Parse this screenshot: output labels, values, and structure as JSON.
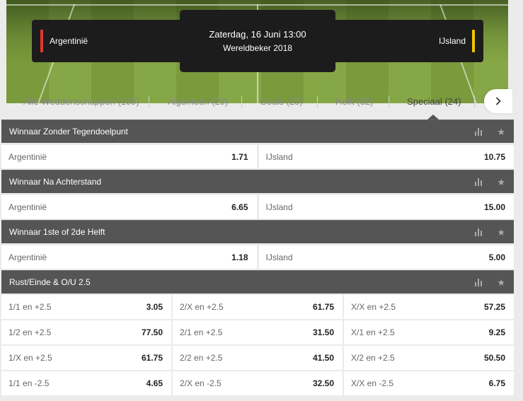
{
  "match": {
    "home_team": "Argentinië",
    "away_team": "IJsland",
    "date": "Zaterdag, 16 Juni 13:00",
    "competition": "Wereldbeker 2018",
    "home_color": "#e03a2c",
    "away_color": "#f2c200"
  },
  "tabs": [
    {
      "label": "Alle Weddenschappen (109)"
    },
    {
      "label": "Algemeen (29)"
    },
    {
      "label": "Goals (25)"
    },
    {
      "label": "Helft (32)"
    },
    {
      "label": "Speciaal (24)",
      "active": true
    }
  ],
  "tab_next_icon": "chevron-right-icon",
  "markets": [
    {
      "title": "Winnaar Zonder Tegendoelpunt",
      "outcomes": [
        {
          "label": "Argentinië",
          "odds": "1.71"
        },
        {
          "label": "IJsland",
          "odds": "10.75"
        }
      ]
    },
    {
      "title": "Winnaar Na Achterstand",
      "outcomes": [
        {
          "label": "Argentinië",
          "odds": "6.65"
        },
        {
          "label": "IJsland",
          "odds": "15.00"
        }
      ]
    },
    {
      "title": "Winnaar 1ste of 2de Helft",
      "outcomes": [
        {
          "label": "Argentinië",
          "odds": "1.18"
        },
        {
          "label": "IJsland",
          "odds": "5.00"
        }
      ]
    },
    {
      "title": "Rust/Einde & O/U 2.5",
      "rows": [
        [
          {
            "label": "1/1 en +2.5",
            "odds": "3.05"
          },
          {
            "label": "2/X en +2.5",
            "odds": "61.75"
          },
          {
            "label": "X/X en +2.5",
            "odds": "57.25"
          }
        ],
        [
          {
            "label": "1/2 en +2.5",
            "odds": "77.50"
          },
          {
            "label": "2/1 en +2.5",
            "odds": "31.50"
          },
          {
            "label": "X/1 en +2.5",
            "odds": "9.25"
          }
        ],
        [
          {
            "label": "1/X en +2.5",
            "odds": "61.75"
          },
          {
            "label": "2/2 en +2.5",
            "odds": "41.50"
          },
          {
            "label": "X/2 en +2.5",
            "odds": "50.50"
          }
        ],
        [
          {
            "label": "1/1 en -2.5",
            "odds": "4.65"
          },
          {
            "label": "2/X en -2.5",
            "odds": "32.50"
          },
          {
            "label": "X/X en -2.5",
            "odds": "6.75"
          }
        ]
      ]
    }
  ],
  "icons": {
    "stats": "bar-chart-icon",
    "favorite": "star-icon"
  }
}
